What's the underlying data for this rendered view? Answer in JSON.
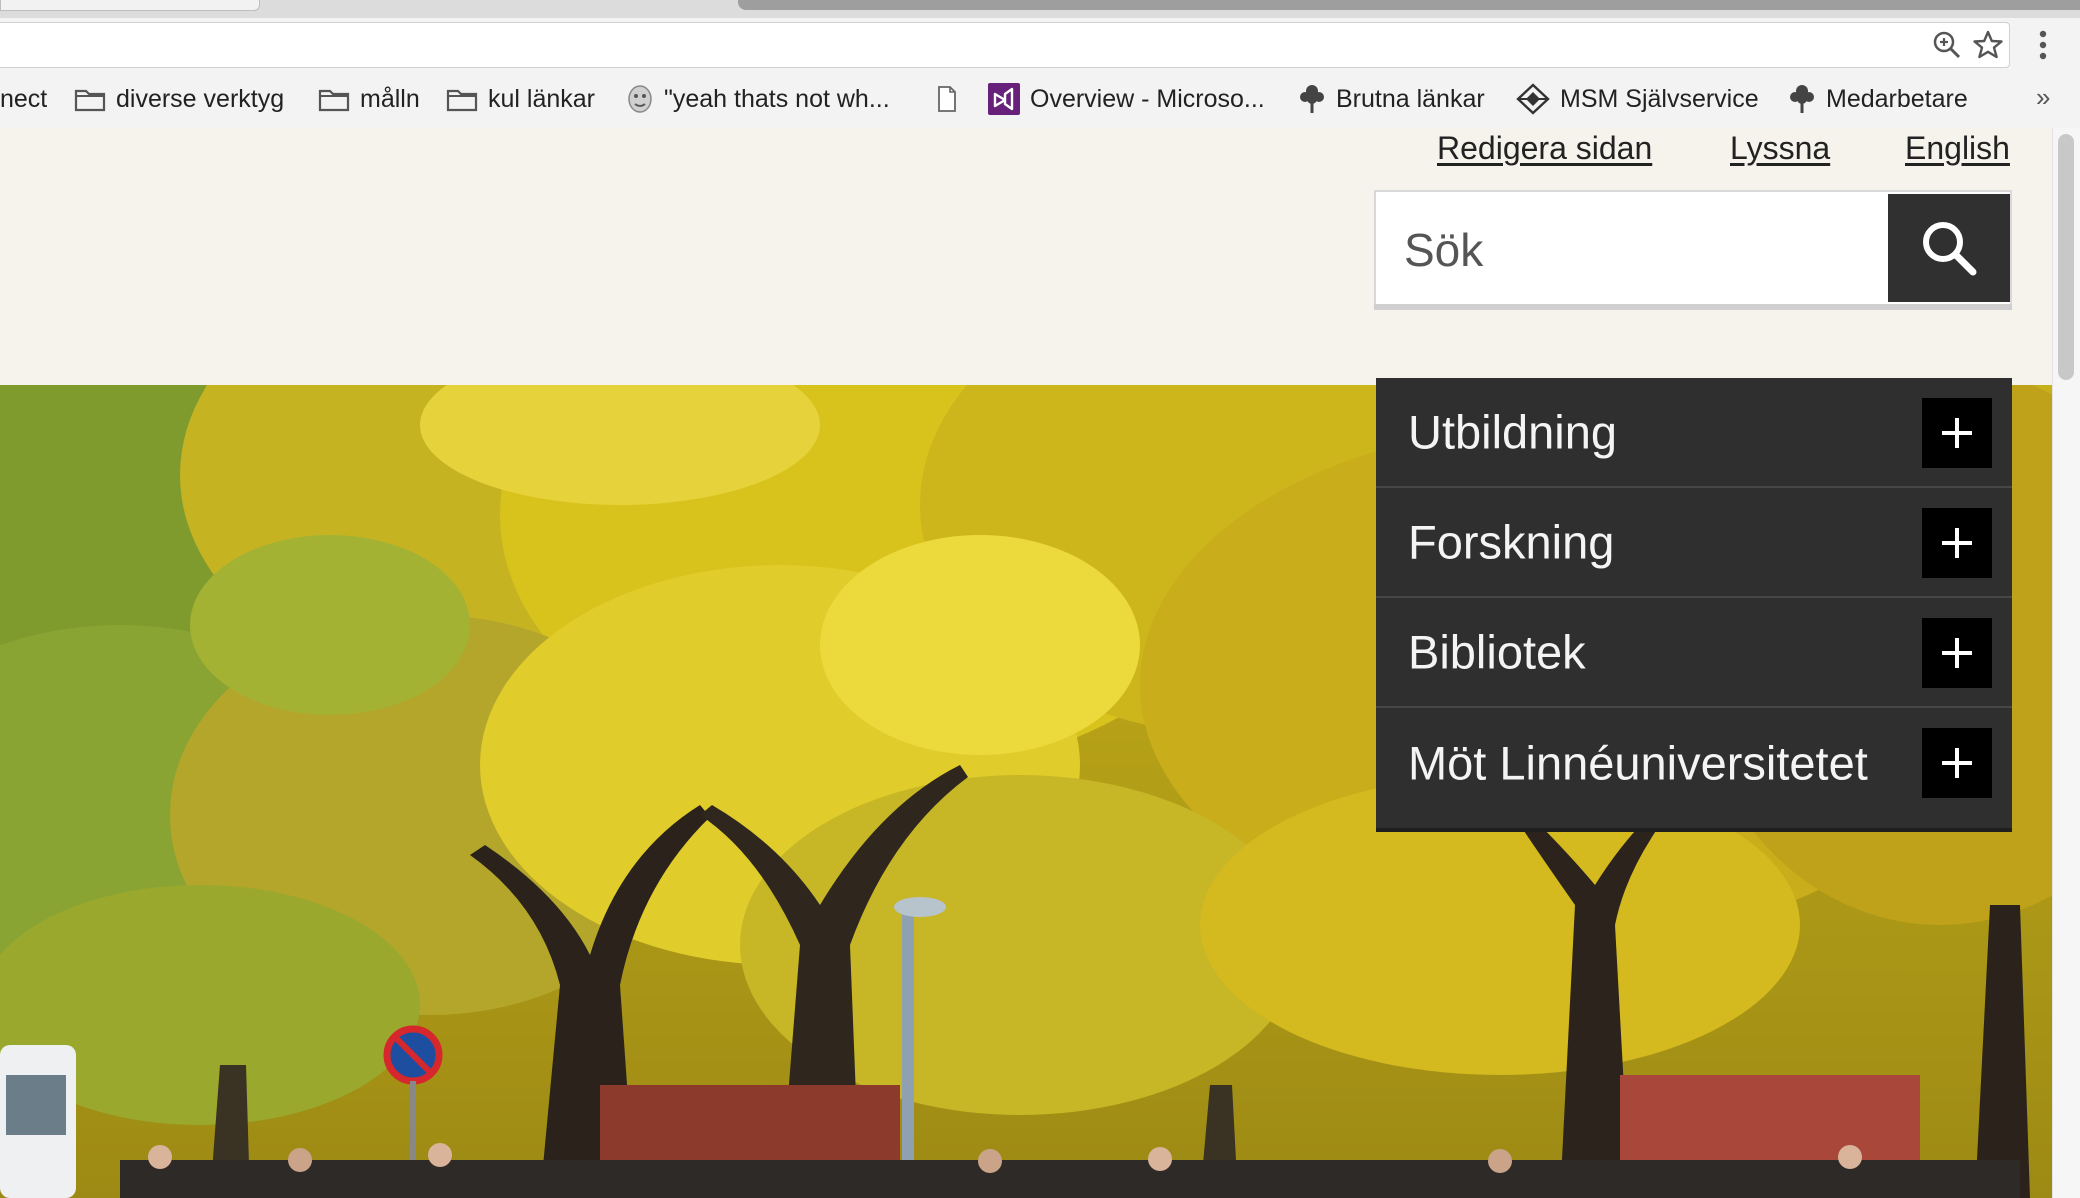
{
  "bookmarks": [
    {
      "label": "nect",
      "icon": "none"
    },
    {
      "label": "diverse verktyg",
      "icon": "folder-icon"
    },
    {
      "label": "målln",
      "icon": "folder-icon"
    },
    {
      "label": "kul länkar",
      "icon": "folder-icon"
    },
    {
      "label": "\"yeah thats not wh...",
      "icon": "avatar-icon"
    },
    {
      "label": "",
      "icon": "page-icon"
    },
    {
      "label": "Overview - Microso...",
      "icon": "visual-studio-icon"
    },
    {
      "label": "Brutna länkar",
      "icon": "tree-icon"
    },
    {
      "label": "MSM Självservice",
      "icon": "diamond-logo-icon"
    },
    {
      "label": "Medarbetare",
      "icon": "tree-icon"
    }
  ],
  "bookmarks_more": "»",
  "header": {
    "links": [
      "Redigera sidan",
      "Lyssna",
      "English"
    ],
    "search_placeholder": "Sök"
  },
  "nav": {
    "items": [
      {
        "label": "Utbildning"
      },
      {
        "label": "Forskning"
      },
      {
        "label": "Bibliotek"
      },
      {
        "label": "Möt Linnéuniversitetet"
      }
    ],
    "background": "#2f2f2f",
    "plus_background": "#000000"
  },
  "colors": {
    "page_background": "#f5f3ec",
    "search_button": "#303030",
    "foliage_yellow": "#d8c21c",
    "foliage_green": "#8aa433"
  }
}
